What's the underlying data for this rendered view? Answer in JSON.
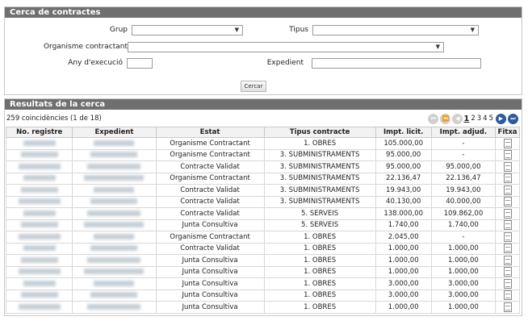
{
  "search": {
    "title": "Cerca de contractes",
    "grup_label": "Grup",
    "tipus_label": "Tipus",
    "organisme_label": "Organisme contractant",
    "any_label": "Any d'execució",
    "expedient_label": "Expedient",
    "button_label": "Cercar"
  },
  "results": {
    "title": "Resultats de la cerca",
    "count": "259 coincidències (1 de 18)",
    "pages": [
      "1",
      "2",
      "3",
      "4",
      "5"
    ],
    "columns": [
      "No. registre",
      "Expedient",
      "Estat",
      "Tipus contracte",
      "Impt. licit.",
      "Impt. adjud.",
      "Fitxa"
    ],
    "rows": [
      {
        "estat": "Organisme Contractant",
        "tipus": "1. OBRES",
        "licit": "105.000,00",
        "adjud": "-"
      },
      {
        "estat": "Organisme Contractant",
        "tipus": "3. SUBMINISTRAMENTS",
        "licit": "95.000,00",
        "adjud": "-"
      },
      {
        "estat": "Contracte Validat",
        "tipus": "3. SUBMINISTRAMENTS",
        "licit": "95.000,00",
        "adjud": "95.000,00"
      },
      {
        "estat": "Organisme Contractant",
        "tipus": "3. SUBMINISTRAMENTS",
        "licit": "22.136,47",
        "adjud": "22.136,47"
      },
      {
        "estat": "Contracte Validat",
        "tipus": "3. SUBMINISTRAMENTS",
        "licit": "19.943,00",
        "adjud": "19.943,00"
      },
      {
        "estat": "Contracte Validat",
        "tipus": "3. SUBMINISTRAMENTS",
        "licit": "40.130,00",
        "adjud": "40.000,00"
      },
      {
        "estat": "Contracte Validat",
        "tipus": "5. SERVEIS",
        "licit": "138.000,00",
        "adjud": "109.862,00"
      },
      {
        "estat": "Junta Consultiva",
        "tipus": "5. SERVEIS",
        "licit": "1.740,00",
        "adjud": "1.740,00"
      },
      {
        "estat": "Organisme Contractant",
        "tipus": "1. OBRES",
        "licit": "2.045,00",
        "adjud": "-"
      },
      {
        "estat": "Contracte Validat",
        "tipus": "1. OBRES",
        "licit": "1.000,00",
        "adjud": "1.000,00"
      },
      {
        "estat": "Junta Consultiva",
        "tipus": "1. OBRES",
        "licit": "1.000,00",
        "adjud": "1.000,00"
      },
      {
        "estat": "Junta Consultiva",
        "tipus": "1. OBRES",
        "licit": "1.000,00",
        "adjud": "1.000,00"
      },
      {
        "estat": "Junta Consultiva",
        "tipus": "1. OBRES",
        "licit": "3.000,00",
        "adjud": "3.000,00"
      },
      {
        "estat": "Junta Consultiva",
        "tipus": "1. OBRES",
        "licit": "3.000,00",
        "adjud": "3.000,00"
      },
      {
        "estat": "Junta Consultiva",
        "tipus": "1. OBRES",
        "licit": "1.000,00",
        "adjud": "1.000,00"
      }
    ]
  }
}
